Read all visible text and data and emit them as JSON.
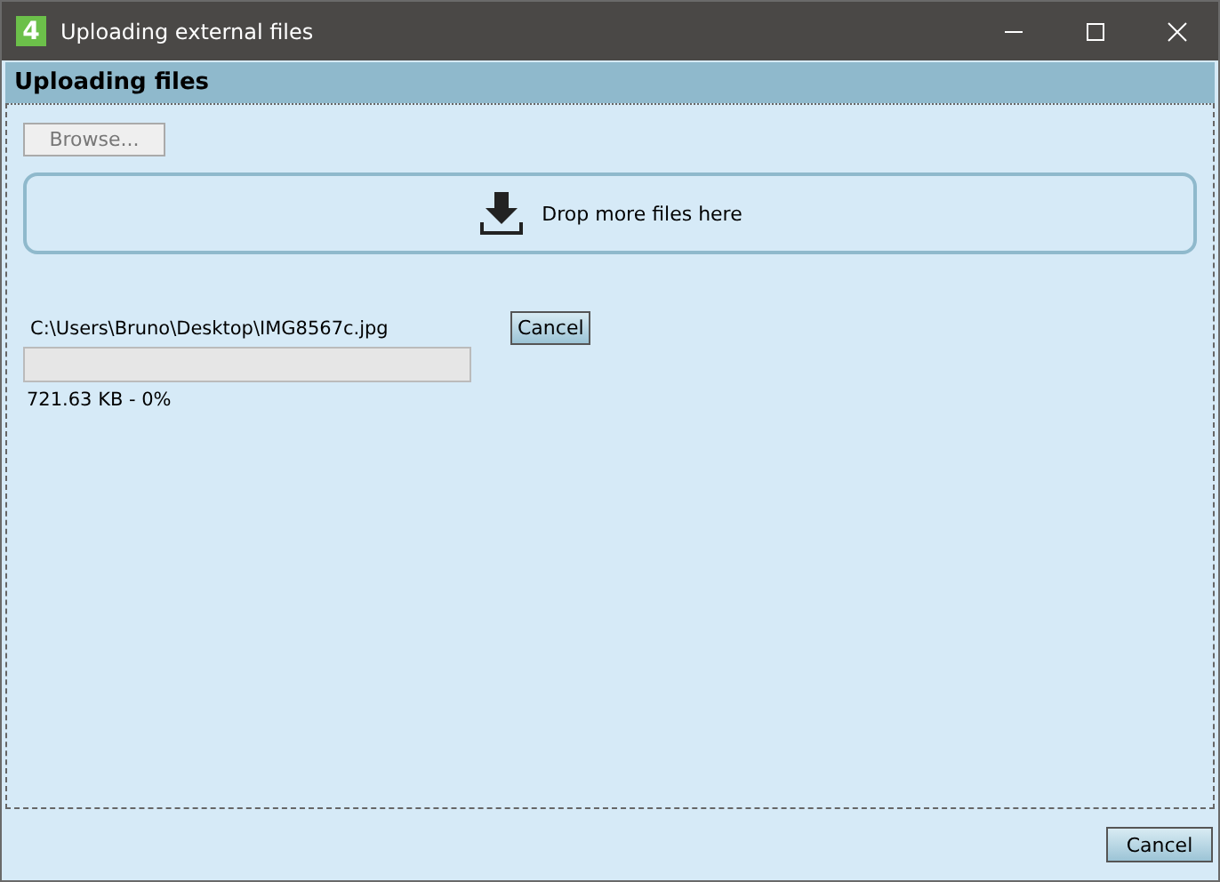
{
  "window": {
    "title": "Uploading external files",
    "app_icon": "4"
  },
  "panel": {
    "title": "Uploading files"
  },
  "browse_button": {
    "label": "Browse...",
    "disabled": true
  },
  "drop_zone": {
    "label": "Drop more files here"
  },
  "uploads": [
    {
      "path": "C:\\Users\\Bruno\\Desktop\\IMG8567c.jpg",
      "cancel": "Cancel",
      "level": 0,
      "status": "721.63 KB - 0%"
    }
  ],
  "footer": {
    "cancel": "Cancel"
  }
}
